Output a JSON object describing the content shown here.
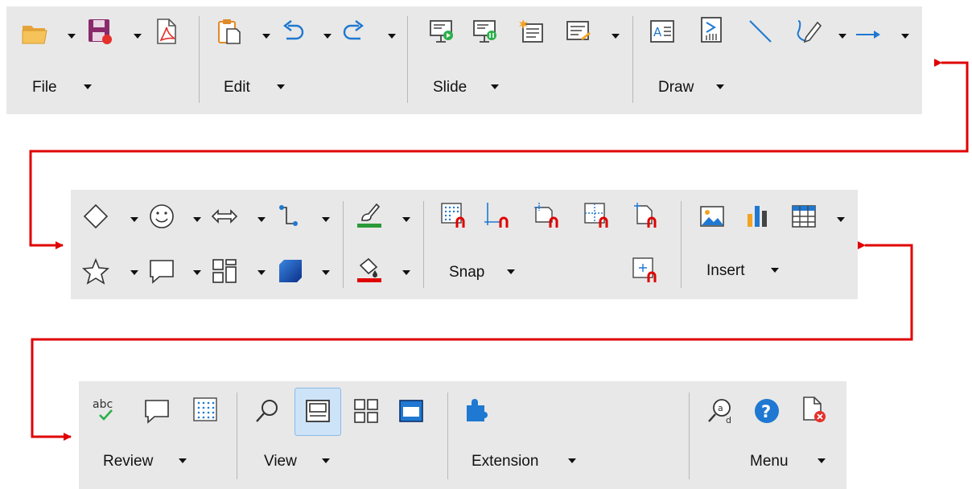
{
  "toolbar1": {
    "groups": [
      {
        "label": "File",
        "icons": [
          "open-folder-icon",
          "save-icon",
          "export-pdf-icon"
        ]
      },
      {
        "label": "Edit",
        "icons": [
          "paste-icon",
          "undo-icon",
          "redo-icon"
        ]
      },
      {
        "label": "Slide",
        "icons": [
          "start-presentation-icon",
          "start-from-current-slide-icon",
          "new-slide-icon",
          "slide-layout-icon"
        ]
      },
      {
        "label": "Draw",
        "icons": [
          "text-box-icon",
          "vertical-text-icon",
          "line-icon",
          "curve-icon",
          "arrow-line-icon"
        ]
      }
    ]
  },
  "toolbar2": {
    "groups": [
      {
        "label": "",
        "icons": [
          "diamond-basic-shape-icon",
          "smiley-symbol-shape-icon",
          "block-arrow-shape-icon",
          "connector-icon",
          "line-color-icon",
          "star-shape-icon",
          "callout-shape-icon",
          "flowchart-shape-icon",
          "3d-object-icon",
          "fill-color-icon"
        ]
      },
      {
        "label": "Snap",
        "icons": [
          "snap-to-grid-icon",
          "snap-to-page-margins-icon",
          "snap-to-object-border-icon",
          "snap-to-snap-lines-icon",
          "snap-to-object-points-icon",
          "snap-to-page-center-icon"
        ]
      },
      {
        "label": "Insert",
        "icons": [
          "insert-image-icon",
          "insert-chart-icon",
          "insert-table-icon"
        ]
      }
    ]
  },
  "toolbar3": {
    "groups": [
      {
        "label": "Review",
        "icons": [
          "spelling-icon",
          "comment-icon",
          "grid-icon"
        ]
      },
      {
        "label": "View",
        "icons": [
          "zoom-icon",
          "normal-view-icon",
          "slide-sorter-icon",
          "master-slide-icon"
        ]
      },
      {
        "label": "Extension",
        "icons": [
          "extension-puzzle-icon"
        ]
      },
      {
        "label": "Menu",
        "icons": [
          "find-replace-icon",
          "help-icon",
          "close-document-icon"
        ]
      }
    ]
  },
  "colors": {
    "toolbar_bg": "#e8e8e8",
    "arrow": "#e00000",
    "accent_blue": "#1f78d1",
    "active_bg": "#cde3f7"
  }
}
